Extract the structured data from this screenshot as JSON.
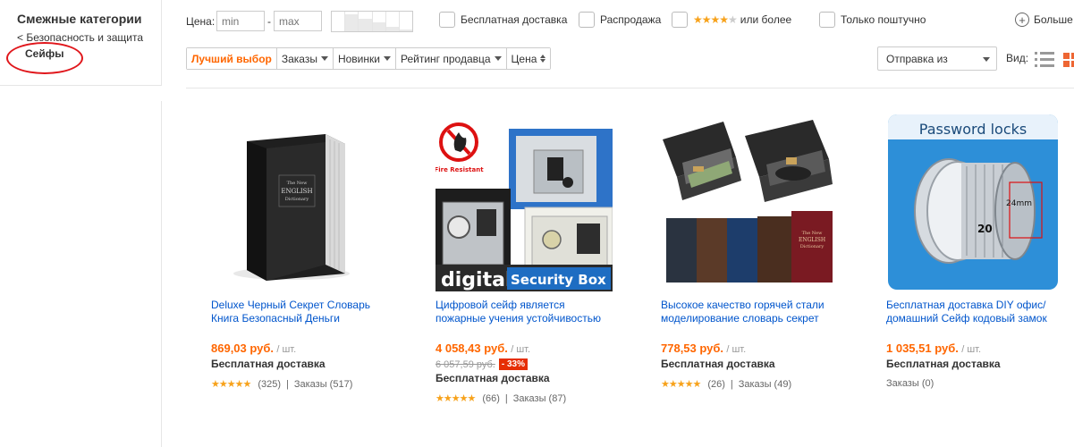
{
  "sidebar": {
    "title": "Смежные категории",
    "parent": "< Безопасность и защита",
    "current": "Сейфы"
  },
  "filters": {
    "price_label": "Цена:",
    "min_placeholder": "min",
    "dash": "-",
    "max_placeholder": "max",
    "free_shipping": "Бесплатная доставка",
    "sale": "Распродажа",
    "rating_suffix": "или более",
    "rating_stars": "★★★★",
    "rating_star_off": "★",
    "single_piece": "Только поштучно",
    "more": "Больше"
  },
  "sort": {
    "best": "Лучший выбор",
    "orders": "Заказы",
    "newest": "Новинки",
    "seller_rating": "Рейтинг продавца",
    "price": "Цена"
  },
  "ship_from": "Отправка из",
  "view_label": "Вид:",
  "products": [
    {
      "title": "Deluxe Черный Секрет Словарь Книга Безопасный Деньги",
      "price": "869,03 руб.",
      "unit": "/ шт.",
      "shipping": "Бесплатная доставка",
      "stars": "★★★★★",
      "reviews": "(325)",
      "separator": "|",
      "orders": "Заказы (517)",
      "image_text": [
        "The New",
        "ENGLISH",
        "Dictionary"
      ]
    },
    {
      "title": "Цифровой сейф является пожарные учения устойчивостью",
      "price": "4 058,43 руб.",
      "unit": "/ шт.",
      "old_price": "6 057,59 руб.",
      "discount": "- 33%",
      "shipping": "Бесплатная доставка",
      "stars": "★★★★★",
      "reviews": "(66)",
      "separator": "|",
      "orders": "Заказы (87)",
      "image_text": [
        "Fire Resistant",
        "digital",
        "Security Box"
      ]
    },
    {
      "title": "Высокое качество горячей стали моделирование словарь секрет",
      "price": "778,53 руб.",
      "unit": "/ шт.",
      "shipping": "Бесплатная доставка",
      "stars": "★★★★★",
      "reviews": "(26)",
      "separator": "|",
      "orders": "Заказы (49)",
      "image_text": [
        "The New",
        "ENGLISH",
        "Dictionary"
      ]
    },
    {
      "title": "Бесплатная доставка DIY офис/домашний Сейф кодовый замок",
      "price": "1 035,51 руб.",
      "unit": "/ шт.",
      "shipping": "Бесплатная доставка",
      "orders": "Заказы (0)",
      "image_text": [
        "Password locks",
        "24mm",
        "20"
      ]
    }
  ],
  "colors": {
    "accent": "#ff6600",
    "link": "#0055cc",
    "star": "#f7a21b",
    "discount": "#e62e04",
    "highlight_ring": "#e0161b"
  }
}
